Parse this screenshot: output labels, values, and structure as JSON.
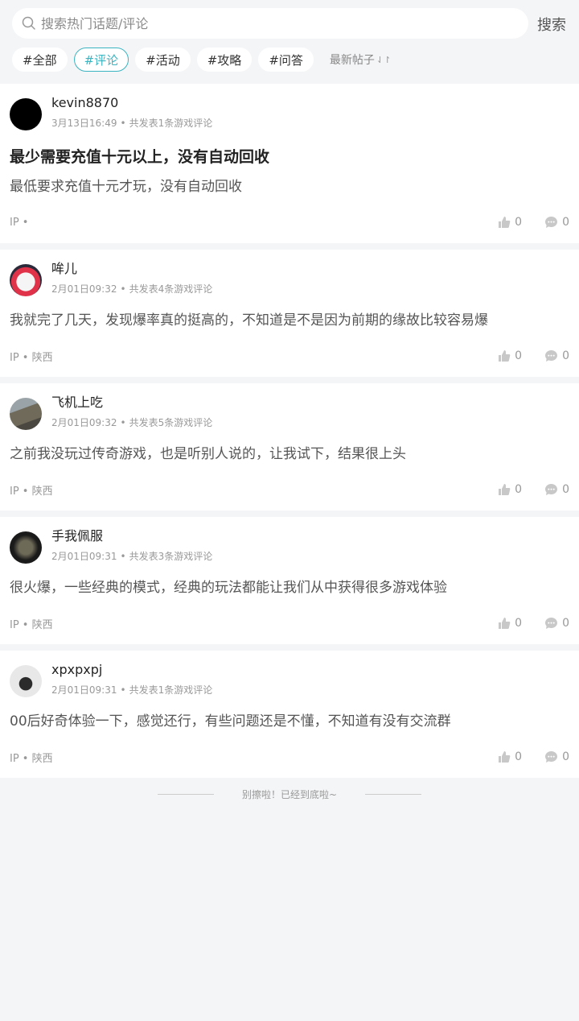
{
  "search": {
    "placeholder": "搜索热门话题/评论",
    "button_label": "搜索"
  },
  "tags": [
    "#全部",
    "#评论",
    "#活动",
    "#攻略",
    "#问答"
  ],
  "active_tag": "#评论",
  "sort_label": "最新帖子",
  "colors": {
    "accent": "#3bb4c1",
    "background": "#f4f5f7"
  },
  "posts": [
    {
      "username": "kevin8870",
      "time": "3月13日16:49",
      "stats": "共发表1条游戏评论",
      "title": "最少需要充值十元以上，没有自动回收",
      "content": "最低要求充值十元才玩，没有自动回收",
      "ip": "IP •",
      "likes": "0",
      "comments": "0"
    },
    {
      "username": "哞儿",
      "time": "2月01日09:32",
      "stats": "共发表4条游戏评论",
      "title": "",
      "content": "我就完了几天，发现爆率真的挺高的，不知道是不是因为前期的缘故比较容易爆",
      "ip": "IP • 陕西",
      "likes": "0",
      "comments": "0"
    },
    {
      "username": "飞机上吃",
      "time": "2月01日09:32",
      "stats": "共发表5条游戏评论",
      "title": "",
      "content": "之前我没玩过传奇游戏，也是听别人说的，让我试下，结果很上头",
      "ip": "IP • 陕西",
      "likes": "0",
      "comments": "0"
    },
    {
      "username": "手我佩服",
      "time": "2月01日09:31",
      "stats": "共发表3条游戏评论",
      "title": "",
      "content": "很火爆，一些经典的模式，经典的玩法都能让我们从中获得很多游戏体验",
      "ip": "IP • 陕西",
      "likes": "0",
      "comments": "0"
    },
    {
      "username": "xpxpxpj",
      "time": "2月01日09:31",
      "stats": "共发表1条游戏评论",
      "title": "",
      "content": "00后好奇体验一下，感觉还行，有些问题还是不懂，不知道有没有交流群",
      "ip": "IP • 陕西",
      "likes": "0",
      "comments": "0"
    }
  ],
  "end_text": "别擦啦！已经到底啦~"
}
